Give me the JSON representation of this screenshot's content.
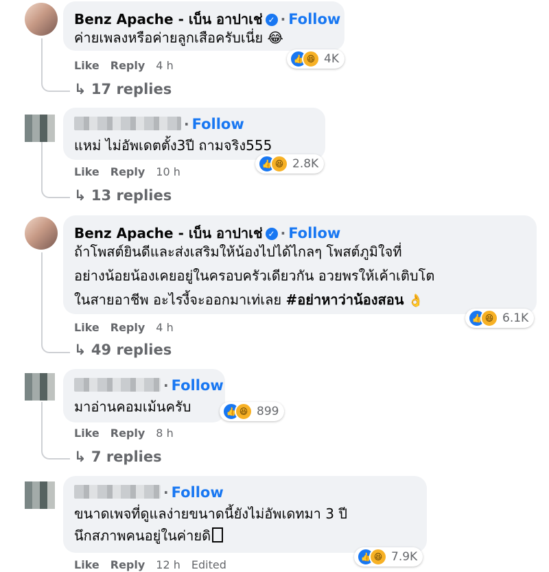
{
  "comments": [
    {
      "name": "Benz Apache - เบ็น อาปาเช่",
      "verified": true,
      "follow": "Follow",
      "lines": [
        "ค่ายเพลงหรือค่ายลูกเสือครับเนี่ย 😂"
      ],
      "reaction_count": "4K",
      "actions": {
        "like": "Like",
        "reply": "Reply",
        "time": "4 h"
      },
      "replies": "↳ 17 replies"
    },
    {
      "name": "",
      "verified": false,
      "follow": "Follow",
      "lines": [
        "แหม่ ไม่อัพเดตตั้ง3ปี ถามจริง555"
      ],
      "reaction_count": "2.8K",
      "actions": {
        "like": "Like",
        "reply": "Reply",
        "time": "10 h"
      },
      "replies": "↳ 13 replies"
    },
    {
      "name": "Benz Apache - เบ็น อาปาเช่",
      "verified": true,
      "follow": "Follow",
      "lines": [
        "ถ้าโพสต์ยินดีและส่งเสริมให้น้องไปได้ไกลๆ โพสต์ภูมิใจที่",
        "อย่างน้อยน้องเคยอยู่ในครอบครัวเดียวกัน อวยพรให้เค้าเติบโต",
        "ในสายอาชีพ อะไรงี้จะออกมาเท่เลย "
      ],
      "hashtag": "#อย่าหาว่าน้องสอน",
      "hashtag_emoji": "👌",
      "reaction_count": "6.1K",
      "actions": {
        "like": "Like",
        "reply": "Reply",
        "time": "4 h"
      },
      "replies": "↳ 49 replies"
    },
    {
      "name": "",
      "verified": false,
      "follow": "Follow",
      "lines": [
        "มาอ่านคอมเม้นครับ"
      ],
      "reaction_count": "899",
      "actions": {
        "like": "Like",
        "reply": "Reply",
        "time": "8 h"
      },
      "replies": "↳ 7 replies"
    },
    {
      "name": "",
      "verified": false,
      "follow": "Follow",
      "lines": [
        "ขนาดเพจที่ดูแลง่ายขนาดนี้ยังไม่อัพเดทมา 3 ปี",
        "นึกสภาพคนอยู่ในค่ายดิ"
      ],
      "reaction_count": "7.9K",
      "actions": {
        "like": "Like",
        "reply": "Reply",
        "time": "12 h",
        "edited": "Edited"
      }
    }
  ],
  "colors": {
    "follow": "#1877f2",
    "bubble": "#f0f2f5",
    "meta": "#65676b"
  }
}
